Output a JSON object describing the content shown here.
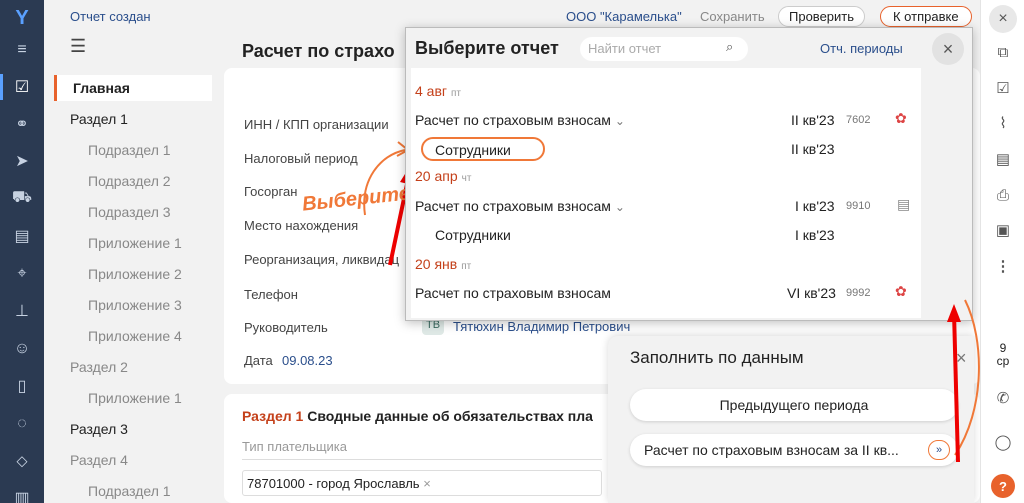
{
  "left_rail": {
    "icons": [
      "logo-icon",
      "menu-icon",
      "report-check-icon",
      "handshake-icon",
      "send-icon",
      "truck-icon",
      "building-icon",
      "map-pin-icon",
      "staff-icon",
      "people-icon",
      "document-icon",
      "chat-icon",
      "tag-icon",
      "app-icon"
    ]
  },
  "header": {
    "status": "Отчет создан",
    "org": "ООО \"Карамелька\"",
    "save": "Сохранить",
    "check": "Проверить",
    "to_send": "К отправке"
  },
  "sidebar": {
    "items": [
      {
        "label": "Главная",
        "type": "active"
      },
      {
        "label": "Раздел 1",
        "type": "section"
      },
      {
        "label": "Подраздел 1",
        "type": "sub"
      },
      {
        "label": "Подраздел 2",
        "type": "sub"
      },
      {
        "label": "Подраздел 3",
        "type": "sub"
      },
      {
        "label": "Приложение 1",
        "type": "sub"
      },
      {
        "label": "Приложение 2",
        "type": "sub"
      },
      {
        "label": "Приложение 3",
        "type": "sub"
      },
      {
        "label": "Приложение 4",
        "type": "sub"
      },
      {
        "label": "Раздел 2",
        "type": "muted"
      },
      {
        "label": "Приложение 1",
        "type": "sub"
      },
      {
        "label": "Раздел 3",
        "type": "section"
      },
      {
        "label": "Раздел 4",
        "type": "muted"
      },
      {
        "label": "Подраздел 1",
        "type": "sub"
      }
    ]
  },
  "main": {
    "title": "Расчет по страхо",
    "fields": [
      "ИНН / КПП организации",
      "Налоговый период",
      "Госорган",
      "Место нахождения",
      "Реорганизация, ликвидац",
      "Телефон",
      "Руководитель"
    ],
    "manager_initials": "ТВ",
    "manager_name": "Тятюхин Владимир Петрович",
    "date_label": "Дата",
    "date_value": "09.08.23",
    "section_title_prefix": "Раздел 1",
    "section_title": "Сводные данные об обязательствах пла",
    "payer_type_placeholder": "Тип плательщика",
    "oktmo_tag": "78701000 - город Ярославль"
  },
  "annotation": {
    "hint": "Выберите"
  },
  "modal": {
    "title": "Выберите отчет",
    "search_placeholder": "Найти отчет",
    "periods_link": "Отч. периоды",
    "groups": [
      {
        "date": "4 авг",
        "weekday": "пт",
        "rows": [
          {
            "name": "Расчет по страховым взносам",
            "expandable": true,
            "period": "II кв'23",
            "num": "7602",
            "icon": "stamp-icon"
          },
          {
            "name": "Сотрудники",
            "sub": true,
            "period": "II кв'23",
            "num": "",
            "icon": ""
          }
        ]
      },
      {
        "date": "20 апр",
        "weekday": "чт",
        "rows": [
          {
            "name": "Расчет по страховым взносам",
            "expandable": true,
            "period": "I кв'23",
            "num": "9910",
            "icon": "doc-icon"
          },
          {
            "name": "Сотрудники",
            "sub": true,
            "period": "I кв'23",
            "num": "",
            "icon": ""
          }
        ]
      },
      {
        "date": "20 янв",
        "weekday": "пт",
        "rows": [
          {
            "name": "Расчет по страховым взносам",
            "expandable": false,
            "period": "VI кв'23",
            "num": "9992",
            "icon": "stamp-icon"
          }
        ]
      }
    ]
  },
  "fill_panel": {
    "title": "Заполнить по данным",
    "option1": "Предыдущего периода",
    "option2": "Расчет по страховым взносам за II кв..."
  },
  "right_rail": {
    "calendar_day": "9",
    "calendar_weekday": "ср",
    "icons": [
      "close-icon",
      "copy-icon",
      "report-icon",
      "attach-icon",
      "docs-icon",
      "print-icon",
      "save-icon",
      "more-icon",
      "phone-icon",
      "chat-icon",
      "help-icon"
    ]
  }
}
